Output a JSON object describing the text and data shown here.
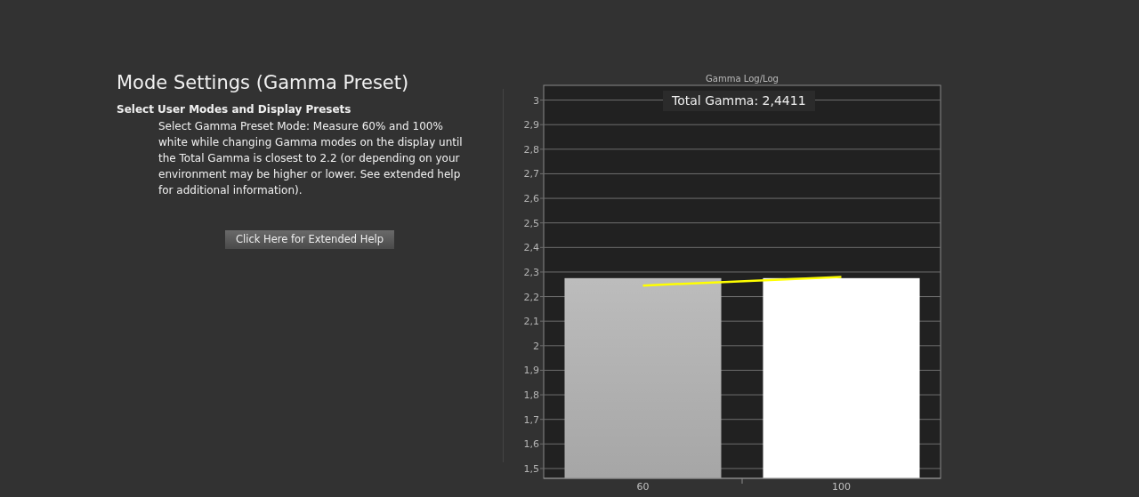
{
  "section": {
    "title": "Mode Settings (Gamma Preset)",
    "subtitle": "Select User Modes and Display Presets",
    "description": "Select Gamma Preset Mode: Measure 60% and 100% white while changing Gamma modes on the display until the Total Gamma is closest to 2.2 (or depending on your environment may be higher or lower. See extended help for additional information).",
    "help_button": "Click Here for Extended Help"
  },
  "chart": {
    "overlay_label": "Total Gamma: 2,4411",
    "chart_data": {
      "type": "bar",
      "title": "Gamma Log/Log",
      "categories": [
        "60",
        "100"
      ],
      "grid": true,
      "ylim": [
        1.46,
        3.06
      ],
      "yticks": [
        {
          "value": 1.5,
          "label": "1,5"
        },
        {
          "value": 1.6,
          "label": "1,6"
        },
        {
          "value": 1.7,
          "label": "1,7"
        },
        {
          "value": 1.8,
          "label": "1,8"
        },
        {
          "value": 1.9,
          "label": "1,9"
        },
        {
          "value": 2,
          "label": "2"
        },
        {
          "value": 2.1,
          "label": "2,1"
        },
        {
          "value": 2.2,
          "label": "2,2"
        },
        {
          "value": 2.3,
          "label": "2,3"
        },
        {
          "value": 2.4,
          "label": "2,4"
        },
        {
          "value": 2.5,
          "label": "2,5"
        },
        {
          "value": 2.6,
          "label": "2,6"
        },
        {
          "value": 2.7,
          "label": "2,7"
        },
        {
          "value": 2.8,
          "label": "2,8"
        },
        {
          "value": 2.9,
          "label": "2,9"
        },
        {
          "value": 3,
          "label": "3"
        }
      ],
      "series": [
        {
          "type": "bar",
          "color": "#a6a6a6",
          "values": [
            2.275,
            null
          ]
        },
        {
          "type": "bar",
          "color": "#ffffff",
          "values": [
            null,
            2.275
          ]
        },
        {
          "type": "line",
          "color": "#ffff00",
          "values": [
            2.245,
            2.28
          ]
        }
      ]
    }
  }
}
